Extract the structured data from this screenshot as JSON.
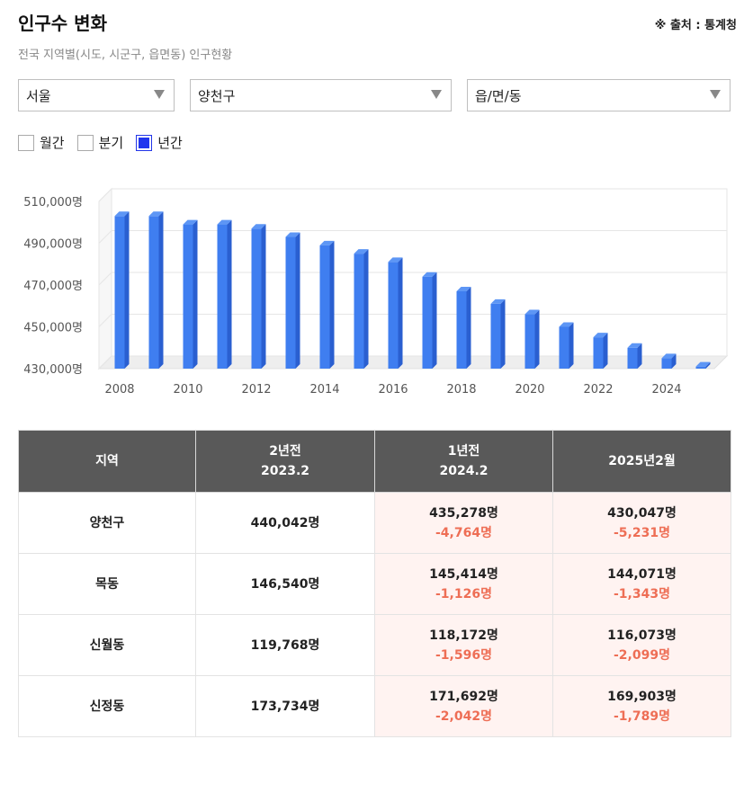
{
  "header": {
    "title": "인구수 변화",
    "source": "※ 출처 : 통계청",
    "subtitle": "전국 지역별(시도, 시군구, 읍면동) 인구현황"
  },
  "filters": {
    "province": "서울",
    "district": "양천구",
    "town": "읍/면/동"
  },
  "period": {
    "monthly": "월간",
    "quarterly": "분기",
    "yearly": "년간",
    "selected": "yearly"
  },
  "colors": {
    "bar_front": "#3f7ef0",
    "bar_side": "#2a5fd0",
    "bar_top": "#5d96f5",
    "negative": "#ee6e55",
    "header_bg": "#595959"
  },
  "chart_data": {
    "type": "bar",
    "categories": [
      "2008",
      "2009",
      "2010",
      "2011",
      "2012",
      "2013",
      "2014",
      "2015",
      "2016",
      "2017",
      "2018",
      "2019",
      "2020",
      "2021",
      "2022",
      "2023",
      "2024",
      "2025"
    ],
    "values": [
      503000,
      503000,
      499000,
      499000,
      497000,
      493000,
      489000,
      485000,
      481000,
      474000,
      467000,
      461000,
      456000,
      450000,
      445000,
      440000,
      435000,
      431000
    ],
    "ylim": [
      430000,
      510000
    ],
    "yticks": [
      "430,000명",
      "450,000명",
      "470,000명",
      "490,000명",
      "510,000명"
    ],
    "ytick_values": [
      430000,
      450000,
      470000,
      490000,
      510000
    ],
    "xticks": [
      "2008",
      "2010",
      "2012",
      "2014",
      "2016",
      "2018",
      "2020",
      "2022",
      "2024"
    ],
    "grid": true
  },
  "table": {
    "headers": [
      {
        "line1": "지역",
        "line2": ""
      },
      {
        "line1": "2년전",
        "line2": "2023.2"
      },
      {
        "line1": "1년전",
        "line2": "2024.2"
      },
      {
        "line1": "2025년2월",
        "line2": ""
      }
    ],
    "rows": [
      {
        "region": "양천구",
        "y2023": "440,042명",
        "y2024": "435,278명",
        "y2024_change": "-4,764명",
        "y2025": "430,047명",
        "y2025_change": "-5,231명"
      },
      {
        "region": "목동",
        "y2023": "146,540명",
        "y2024": "145,414명",
        "y2024_change": "-1,126명",
        "y2025": "144,071명",
        "y2025_change": "-1,343명"
      },
      {
        "region": "신월동",
        "y2023": "119,768명",
        "y2024": "118,172명",
        "y2024_change": "-1,596명",
        "y2025": "116,073명",
        "y2025_change": "-2,099명"
      },
      {
        "region": "신정동",
        "y2023": "173,734명",
        "y2024": "171,692명",
        "y2024_change": "-2,042명",
        "y2025": "169,903명",
        "y2025_change": "-1,789명"
      }
    ]
  }
}
